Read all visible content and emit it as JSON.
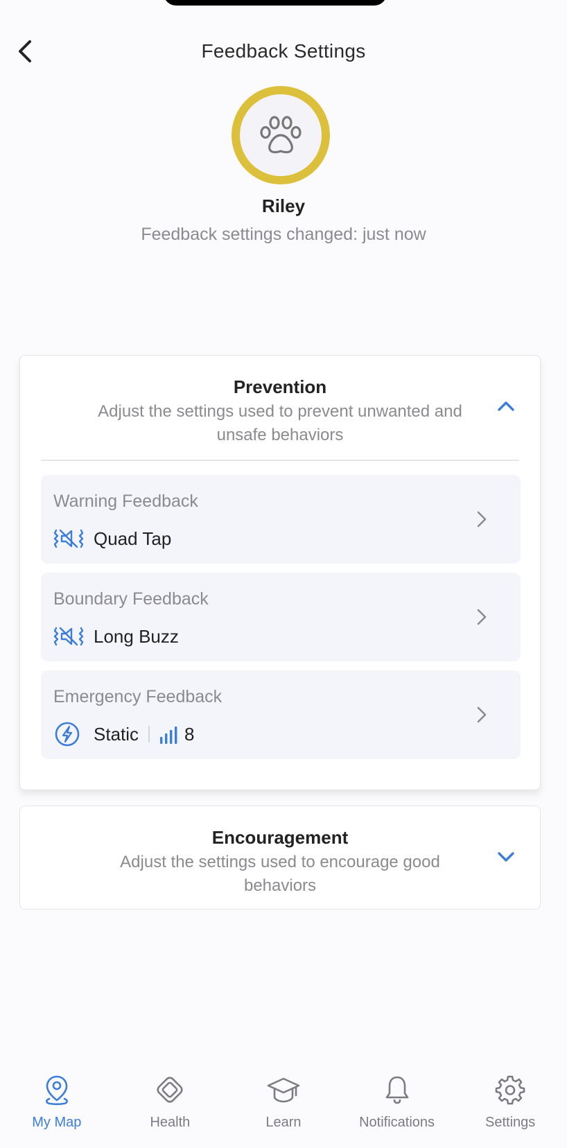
{
  "header": {
    "title": "Feedback Settings",
    "back_icon": "chevron-left-icon"
  },
  "pet": {
    "name": "Riley",
    "status": "Feedback settings changed: just now",
    "avatar_icon": "paw-icon",
    "ring_color": "#dcbf3a"
  },
  "prevention": {
    "title": "Prevention",
    "description": "Adjust the settings used to prevent unwanted and unsafe behaviors",
    "expanded": true,
    "items": [
      {
        "label": "Warning Feedback",
        "value": "Quad Tap",
        "icon": "vibration-icon"
      },
      {
        "label": "Boundary Feedback",
        "value": "Long Buzz",
        "icon": "vibration-icon"
      },
      {
        "label": "Emergency Feedback",
        "value": "Static",
        "icon": "lightning-icon",
        "level": "8",
        "level_icon": "signal-bars-icon"
      }
    ]
  },
  "encouragement": {
    "title": "Encouragement",
    "description": "Adjust the settings used to encourage good behaviors",
    "expanded": false
  },
  "nav": {
    "items": [
      {
        "label": "My Map",
        "icon": "map-pin-icon",
        "active": true
      },
      {
        "label": "Health",
        "icon": "health-diamond-icon",
        "active": false
      },
      {
        "label": "Learn",
        "icon": "graduation-cap-icon",
        "active": false
      },
      {
        "label": "Notifications",
        "icon": "bell-icon",
        "active": false
      },
      {
        "label": "Settings",
        "icon": "gear-icon",
        "active": false
      }
    ]
  },
  "colors": {
    "accent": "#3b7dd8",
    "muted_text": "#8a8a90",
    "item_bg": "#f4f5fb"
  }
}
